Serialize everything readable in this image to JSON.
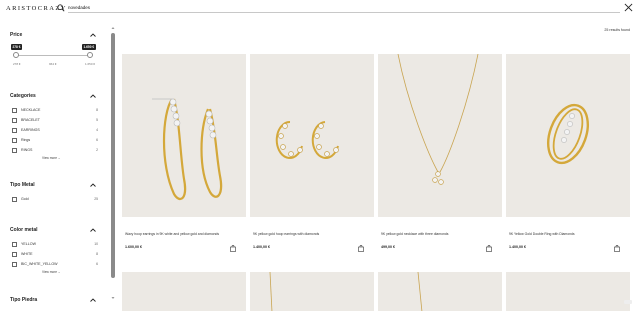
{
  "header": {
    "logo": "ARISTOCRAZY",
    "search_value": "novedades",
    "search_icon": "search-icon",
    "close_icon": "close-icon"
  },
  "filters": {
    "price": {
      "title": "Price",
      "min_badge": "278 €",
      "max_badge": "1.650 €",
      "ticks": [
        "278 €",
        "964 €",
        "1.650 €"
      ]
    },
    "categories": {
      "title": "Categories",
      "items": [
        {
          "label": "NECKLACE",
          "count": "8"
        },
        {
          "label": "BRACELET",
          "count": "5"
        },
        {
          "label": "EARRINGS",
          "count": "4"
        },
        {
          "label": "Rings",
          "count": "6"
        },
        {
          "label": "RINGS",
          "count": "2"
        }
      ],
      "view_more": "View more"
    },
    "tipo_metal": {
      "title": "Tipo Metal",
      "items": [
        {
          "label": "Gold",
          "count": "25"
        }
      ]
    },
    "color_metal": {
      "title": "Color metal",
      "items": [
        {
          "label": "YELLOW",
          "count": "10"
        },
        {
          "label": "WHITE",
          "count": "8"
        },
        {
          "label": "BIC_WHITE_YELLOW",
          "count": "6"
        }
      ],
      "view_more": "View more"
    },
    "tipo_piedra": {
      "title": "Tipo Piedra"
    }
  },
  "results": {
    "count_text": "25 results found",
    "products": [
      {
        "name": "Wavy hoop earrings in 9K white and yellow gold and diamonds",
        "price": "1.600,00 €"
      },
      {
        "name": "9K yellow gold hoop earrings with diamonds",
        "price": "1.400,00 €"
      },
      {
        "name": "9K yellow gold necklace with three diamonds",
        "price": "499,00 €"
      },
      {
        "name": "9K Yellow Gold Double Ring with Diamonds",
        "price": "1.400,00 €"
      }
    ]
  },
  "colors": {
    "gold": "#d4a83a",
    "image_bg": "#ece9e4",
    "badge_bg": "#222222"
  }
}
